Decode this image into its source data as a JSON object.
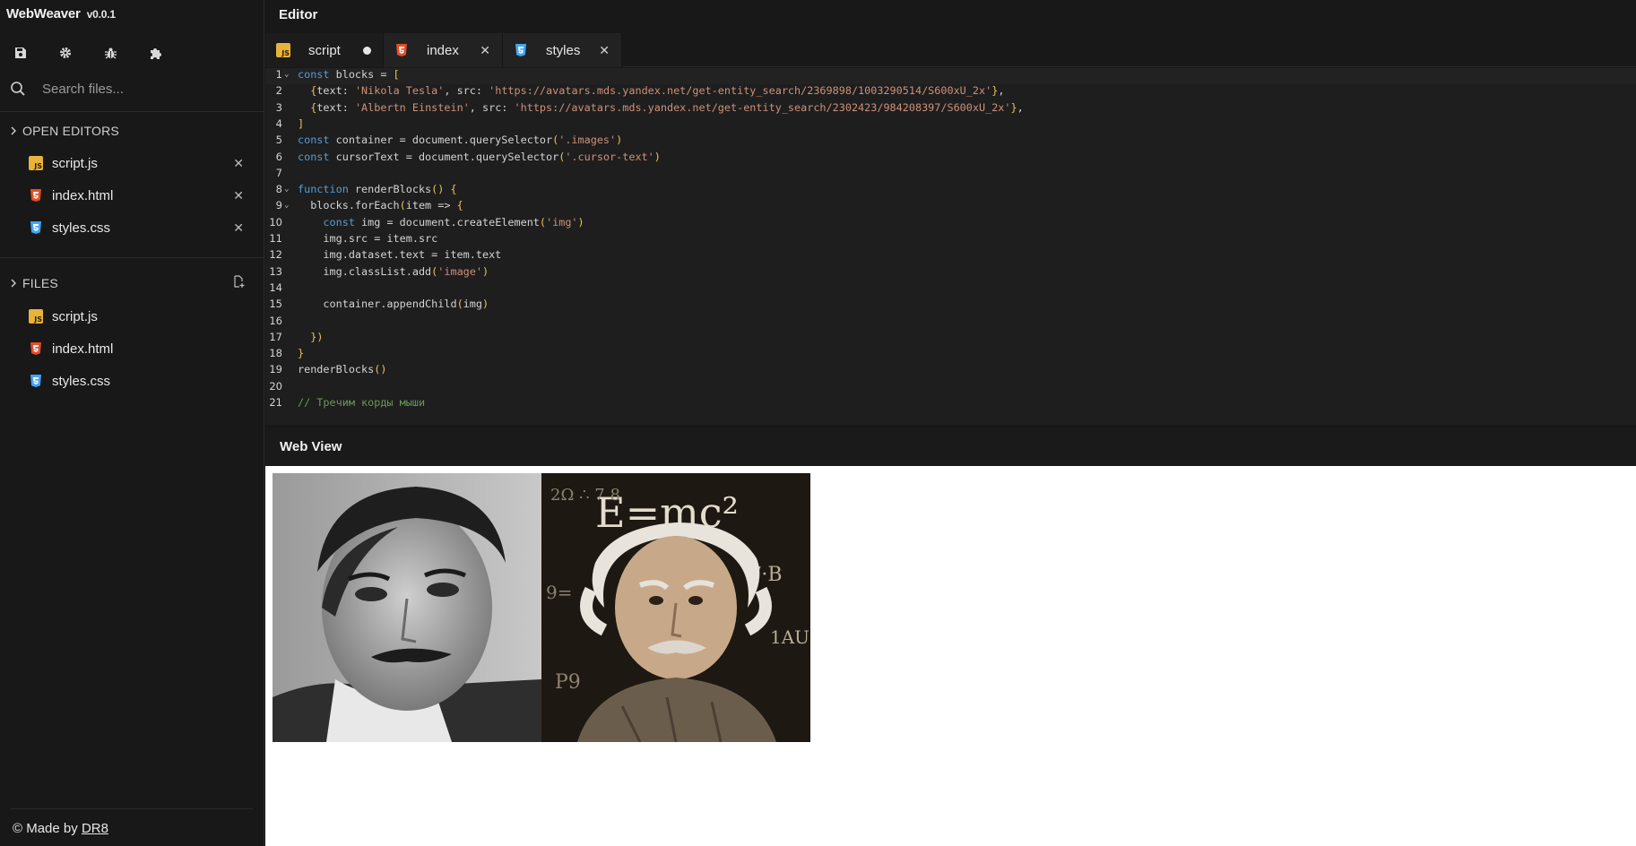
{
  "app": {
    "name": "WebWeaver",
    "version": "v0.0.1"
  },
  "toolbar": [
    {
      "name": "save-icon",
      "title": "Save"
    },
    {
      "name": "gear-icon",
      "title": "Settings"
    },
    {
      "name": "bug-icon",
      "title": "Debug"
    },
    {
      "name": "puzzle-icon",
      "title": "Extensions"
    }
  ],
  "search": {
    "placeholder": "Search files...",
    "value": ""
  },
  "open_editors": {
    "title": "OPEN EDITORS",
    "items": [
      {
        "label": "script.js",
        "icon": "js-file-icon"
      },
      {
        "label": "index.html",
        "icon": "html-file-icon"
      },
      {
        "label": "styles.css",
        "icon": "css-file-icon"
      }
    ]
  },
  "files": {
    "title": "FILES",
    "items": [
      {
        "label": "script.js",
        "icon": "js-file-icon"
      },
      {
        "label": "index.html",
        "icon": "html-file-icon"
      },
      {
        "label": "styles.css",
        "icon": "css-file-icon"
      }
    ]
  },
  "footer": {
    "prefix": "© Made by",
    "link": "DR8"
  },
  "editor": {
    "title": "Editor",
    "tabs": [
      {
        "label": "script",
        "icon": "js-file-icon",
        "modified": true
      },
      {
        "label": "index",
        "icon": "html-file-icon",
        "modified": false
      },
      {
        "label": "styles",
        "icon": "css-file-icon",
        "modified": false
      }
    ],
    "lines": [
      "const blocks = [",
      "  {text: 'Nikola Tesla', src: 'https://avatars.mds.yandex.net/get-entity_search/2369898/1003290514/S600xU_2x'},",
      "  {text: 'Albertn Einstein', src: 'https://avatars.mds.yandex.net/get-entity_search/2302423/984208397/S600xU_2x'},",
      "]",
      "const container = document.querySelector('.images')",
      "const cursorText = document.querySelector('.cursor-text')",
      "",
      "function renderBlocks() {",
      "  blocks.forEach(item => {",
      "    const img = document.createElement('img')",
      "    img.src = item.src",
      "    img.dataset.text = item.text",
      "    img.classList.add('image')",
      "",
      "    container.appendChild(img)",
      "",
      "  })",
      "}",
      "renderBlocks()",
      "",
      "// Тречим корды мыши"
    ]
  },
  "webview": {
    "title": "Web View",
    "images": [
      {
        "alt": "Nikola Tesla"
      },
      {
        "alt": "Albertn Einstein",
        "board_text": "E=mc²"
      }
    ]
  },
  "colors": {
    "background": "#181818",
    "editor_bg": "#1e1e1e",
    "keyword": "#569cd6",
    "string": "#ce9178",
    "comment": "#6a9955",
    "bracket": "#e8c25a",
    "js_icon": "#e8b33a",
    "html_icon": "#e44d26",
    "css_icon": "#42a5f5"
  }
}
